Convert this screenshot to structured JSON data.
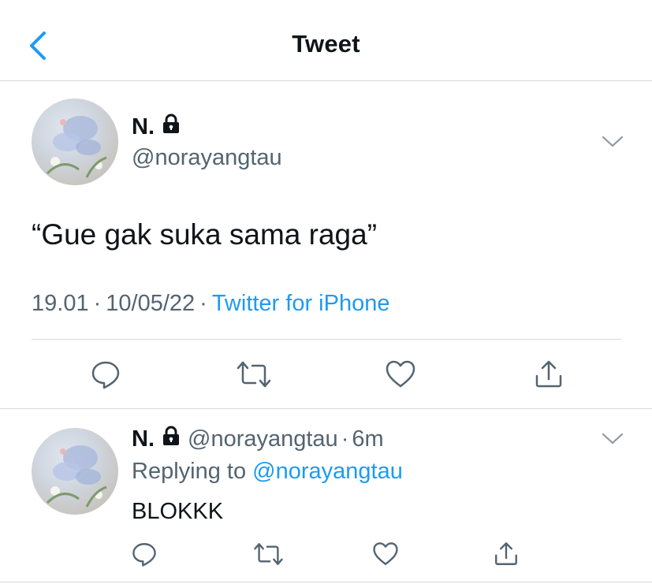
{
  "header": {
    "title": "Tweet",
    "back_icon": "chevron-left-icon",
    "accent_color": "#1d9bf0"
  },
  "tweet": {
    "author_name": "N.",
    "handle": "@norayangtau",
    "text": "“Gue gak suka sama raga”",
    "time": "19.01",
    "separator": "·",
    "date": "10/05/22",
    "source": "Twitter for iPhone",
    "protected_icon": "lock-icon",
    "actions": [
      "reply-icon",
      "retweet-icon",
      "like-icon",
      "share-icon"
    ]
  },
  "reply": {
    "author_name": "N.",
    "handle": "@norayangtau",
    "dot": "·",
    "time": "6m",
    "replying_prefix": "Replying to",
    "replying_to": "@norayangtau",
    "text": "BLOKKK",
    "actions": [
      "reply-icon",
      "retweet-icon",
      "like-icon",
      "share-icon"
    ]
  }
}
